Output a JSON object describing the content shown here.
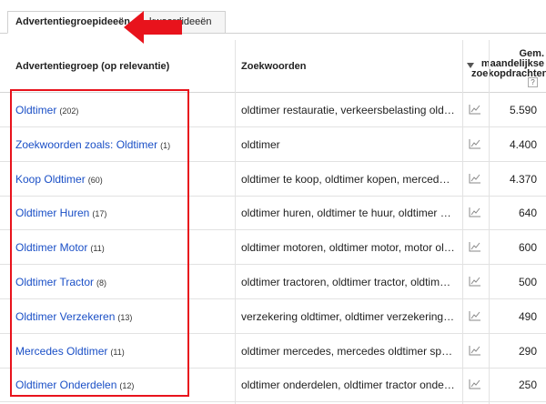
{
  "tabs": [
    {
      "label": "Advertentiegroepideeën",
      "active": true
    },
    {
      "label": "kwoordideeën",
      "active": false
    }
  ],
  "header": {
    "group_col": "Advertentiegroep (op relevantie)",
    "keywords_col": "Zoekwoorden",
    "volume_col_line1": "Gem.",
    "volume_col_line2": "maandelijkse",
    "volume_col_line3": "zoekopdrachten",
    "help": "?"
  },
  "rows": [
    {
      "group": "Oldtimer",
      "count": "(202)",
      "keywords": "oldtimer restauratie, verkeersbelasting oldtimer",
      "volume": "5.590"
    },
    {
      "group": "Zoekwoorden zoals: Oldtimer",
      "count": "(1)",
      "keywords": "oldtimer",
      "volume": "4.400"
    },
    {
      "group": "Koop Oldtimer",
      "count": "(60)",
      "keywords": "oldtimer te koop, oldtimer kopen, mercedes oldtimer",
      "volume": "4.370"
    },
    {
      "group": "Oldtimer Huren",
      "count": "(17)",
      "keywords": "oldtimer huren, oldtimer te huur, oldtimer huren",
      "volume": "640"
    },
    {
      "group": "Oldtimer Motor",
      "count": "(11)",
      "keywords": "oldtimer motoren, oldtimer motor, motor oldtimer",
      "volume": "600"
    },
    {
      "group": "Oldtimer Tractor",
      "count": "(8)",
      "keywords": "oldtimer tractoren, oldtimer tractor, oldtimer tractor",
      "volume": "500"
    },
    {
      "group": "Oldtimer Verzekeren",
      "count": "(13)",
      "keywords": "verzekering oldtimer, oldtimer verzekering, oldtimer",
      "volume": "490"
    },
    {
      "group": "Mercedes Oldtimer",
      "count": "(11)",
      "keywords": "oldtimer mercedes, mercedes oldtimer specialist",
      "volume": "290"
    },
    {
      "group": "Oldtimer Onderdelen",
      "count": "(12)",
      "keywords": "oldtimer onderdelen, oldtimer tractor onderdelen",
      "volume": "250"
    }
  ],
  "icons": {
    "sort": "sort-desc-icon",
    "trend": "trend-chart-icon",
    "annotation_arrow": "red-arrow-icon"
  },
  "colors": {
    "link": "#1a4fc6",
    "highlight": "#e8131c"
  }
}
